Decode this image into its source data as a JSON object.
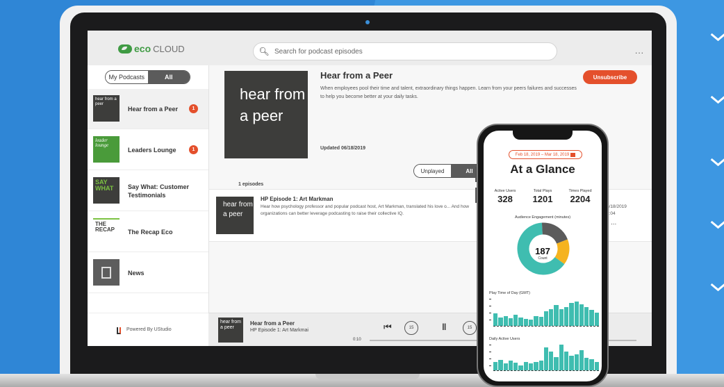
{
  "app": {
    "logo_eco": "eco",
    "logo_cloud": "CLOUD",
    "search_placeholder": "Search for podcast episodes",
    "more_menu": "..."
  },
  "sidebar": {
    "filter_tabs": [
      "My Podcasts",
      "All"
    ],
    "items": [
      {
        "label": "Hear from a Peer",
        "thumb": "hear from a peer",
        "badge": "1",
        "thumb_color": "#3d3d3b"
      },
      {
        "label": "Leaders Lounge",
        "thumb": "leader lounge",
        "badge": "1",
        "thumb_color": "#4a9b3a"
      },
      {
        "label": "Say What: Customer Testimonials",
        "thumb": "SAY WHAT",
        "badge": "",
        "thumb_color": "#3d3d3b"
      },
      {
        "label": "The Recap Eco",
        "thumb": "THE RECAP",
        "badge": "",
        "thumb_color": "#ffffff"
      },
      {
        "label": "News",
        "thumb": "",
        "badge": "",
        "thumb_color": "#5d5d5d"
      }
    ],
    "powered_by": "Powered By UStudio"
  },
  "podcast": {
    "art_text": "hear from a peer",
    "title": "Hear from a Peer",
    "description": "When employees pool their time and talent, extraordinary things happen. Learn from your peers failures and successes to help you become better at your daily tasks.",
    "unsubscribe_label": "Unsubscribe",
    "updated": "Updated 06/18/2019",
    "episode_filter": [
      "Unplayed",
      "All"
    ],
    "episode_count": "1 episodes"
  },
  "episodes": [
    {
      "title": "HP Episode 1: Art Markman",
      "description": "Hear how psychology professor and popular podcast host, Art Markman, translated his love o... And how organizations can better leverage podcasting to raise their collective IQ.",
      "date": "6/18/2019",
      "duration": "2:04",
      "more": "..."
    }
  ],
  "player": {
    "title": "Hear from a Peer",
    "subtitle": "HP Episode 1: Art Markmai",
    "back_label": "15",
    "fwd_label": "15",
    "time": "0:10"
  },
  "phone": {
    "date_range": "Feb 18, 2019 – Mar 18, 2019",
    "title": "At a Glance",
    "metrics": [
      {
        "label": "Active Users",
        "value": "328"
      },
      {
        "label": "Total Plays",
        "value": "1201"
      },
      {
        "label": "Times Played",
        "value": "2204"
      }
    ],
    "engagement_label": "Audience Engagement (minutes)",
    "donut_value": "187",
    "donut_sub": "Count",
    "donut_segments": [
      0.64,
      0.2,
      0.16
    ],
    "donut_colors": [
      "#3fbdb0",
      "#5b5b5b",
      "#f5b31f"
    ],
    "play_time_label": "Play Time of Day (GMT)",
    "play_time_values": [
      0.45,
      0.3,
      0.35,
      0.28,
      0.42,
      0.3,
      0.25,
      0.22,
      0.35,
      0.33,
      0.55,
      0.62,
      0.78,
      0.62,
      0.7,
      0.85,
      0.9,
      0.8,
      0.7,
      0.58,
      0.5
    ],
    "daily_users_label": "Daily Active Users",
    "daily_users_values": [
      0.3,
      0.38,
      0.25,
      0.35,
      0.28,
      0.18,
      0.3,
      0.25,
      0.32,
      0.35,
      0.85,
      0.7,
      0.5,
      0.95,
      0.7,
      0.55,
      0.6,
      0.75,
      0.45,
      0.4,
      0.32
    ]
  },
  "accent": "#e4502c"
}
